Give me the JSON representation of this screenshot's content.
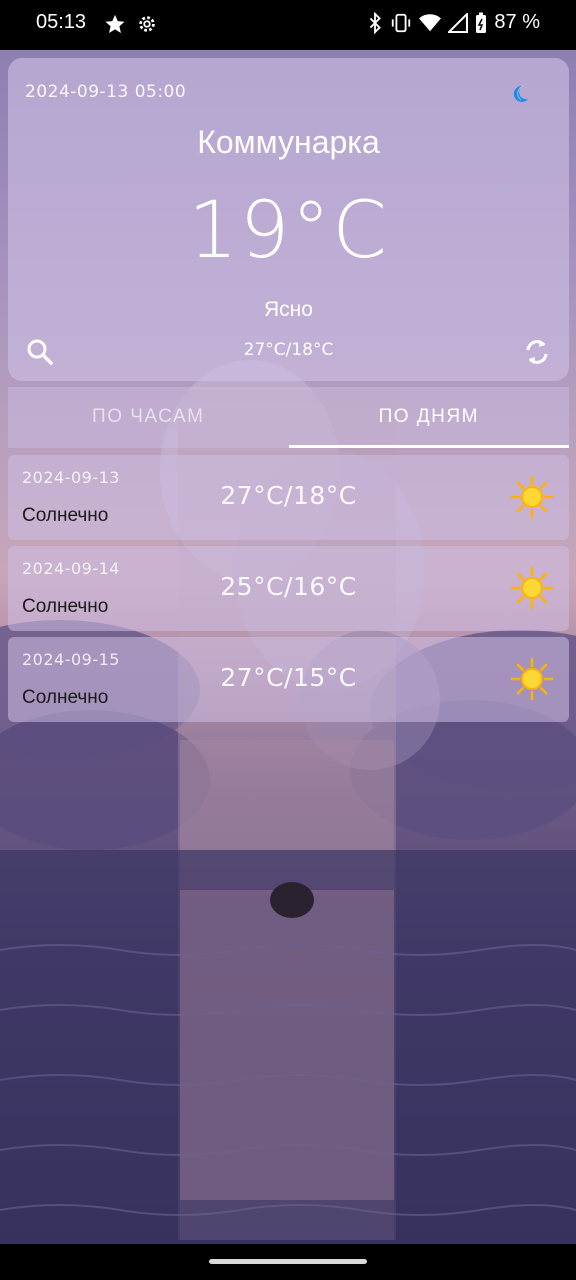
{
  "status_bar": {
    "time": "05:13",
    "battery": "87 %",
    "icons_left": [
      "star-icon",
      "gear-icon"
    ],
    "icons_right": [
      "bluetooth-icon",
      "vibrate-icon",
      "wifi-icon",
      "signal-icon",
      "battery-icon"
    ]
  },
  "weather": {
    "datetime": "2024-09-13 05:00",
    "city": "Коммунарка",
    "temperature": "19°C",
    "condition": "Ясно",
    "min_max": "27°C/18°C",
    "night_icon": "moon-icon",
    "accent_color": "#1e88e5"
  },
  "tabs": [
    {
      "label": "ПО ЧАСАМ",
      "active": false
    },
    {
      "label": "ПО ДНЯМ",
      "active": true
    }
  ],
  "days": [
    {
      "date": "2024-09-13",
      "condition": "Солнечно",
      "temp": "27°C/18°C",
      "icon": "sun-icon"
    },
    {
      "date": "2024-09-14",
      "condition": "Солнечно",
      "temp": "25°C/16°C",
      "icon": "sun-icon"
    },
    {
      "date": "2024-09-15",
      "condition": "Солнечно",
      "temp": "27°C/15°C",
      "icon": "sun-icon"
    }
  ],
  "colors": {
    "card_bg": "#cdbee4",
    "sun": "#ffc107",
    "sun_core": "#fdd835"
  }
}
